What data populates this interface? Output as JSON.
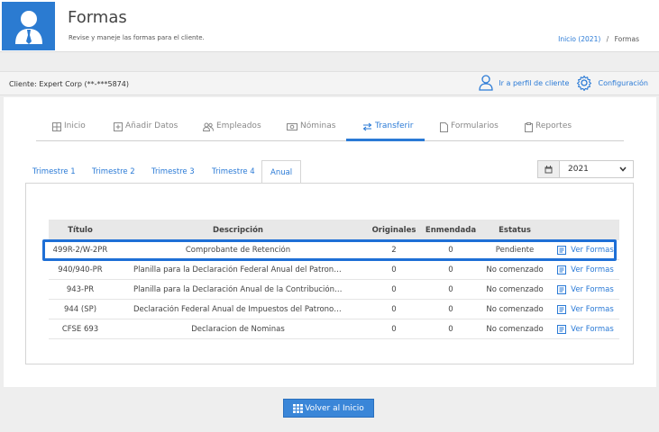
{
  "header": {
    "title": "Formas",
    "subtitle": "Revise y maneje las formas para el cliente.",
    "breadcrumb": {
      "home": "Inicio (2021)",
      "separator": "/",
      "current": "Formas"
    }
  },
  "client_bar": {
    "client_label": "Cliente: Expert Corp (**-***5874)",
    "profile_link": "Ir a perfil de cliente",
    "settings_link": "Configuración"
  },
  "nav_tabs": [
    {
      "label": "Inicio",
      "icon": "grid-icon"
    },
    {
      "label": "Añadir Datos",
      "icon": "plus-square-icon"
    },
    {
      "label": "Empleados",
      "icon": "users-icon"
    },
    {
      "label": "Nóminas",
      "icon": "money-icon"
    },
    {
      "label": "Transferir",
      "icon": "transfer-icon"
    },
    {
      "label": "Formularios",
      "icon": "file-icon"
    },
    {
      "label": "Reportes",
      "icon": "clipboard-icon"
    }
  ],
  "active_nav_tab": "Transferir",
  "sub_tabs": [
    "Trimestre 1",
    "Trimestre 2",
    "Trimestre 3",
    "Trimestre 4",
    "Anual"
  ],
  "active_sub_tab": "Anual",
  "year_select": {
    "value": "2021"
  },
  "table": {
    "headers": [
      "Título",
      "Descripción",
      "Originales",
      "Enmendada",
      "Estatus",
      ""
    ],
    "rows": [
      {
        "title": "499R-2/W-2PR",
        "description": "Comprobante de Retención",
        "originals": "2",
        "amended": "0",
        "status": "Pendiente",
        "action": "Ver Formas"
      },
      {
        "title": "940/940-PR",
        "description": "Planilla para la Declaración Federal Anual del Patrono de...",
        "originals": "0",
        "amended": "0",
        "status": "No comenzado",
        "action": "Ver Formas"
      },
      {
        "title": "943-PR",
        "description": "Planilla para la Declaración Anual de la Contribución Fed...",
        "originals": "0",
        "amended": "0",
        "status": "No comenzado",
        "action": "Ver Formas"
      },
      {
        "title": "944 (SP)",
        "description": "Declaración Federal Anual de Impuestos del Patrono o Empl...",
        "originals": "0",
        "amended": "0",
        "status": "No comenzado",
        "action": "Ver Formas"
      },
      {
        "title": "CFSE 693",
        "description": "Declaracion de Nominas",
        "originals": "0",
        "amended": "0",
        "status": "No comenzado",
        "action": "Ver Formas"
      }
    ]
  },
  "footer": {
    "back_button": "Volver al Inicio"
  },
  "colors": {
    "accent": "#2a7ad6",
    "highlight": "#1e6fd6",
    "header_avatar_bg": "#2b7bd1"
  }
}
